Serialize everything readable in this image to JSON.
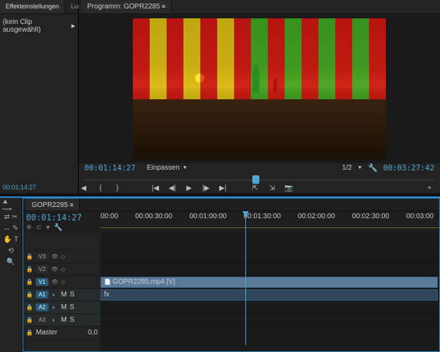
{
  "effects_panel": {
    "tab1": "Effekteinstellungen",
    "tab2": "Lume",
    "no_clip": "(kein Clip ausgewählt)",
    "timecode": "00:01:14:27"
  },
  "program": {
    "panel_label": "Programm:",
    "sequence": "GOPR2285",
    "current_tc": "00:01:14:27",
    "fit_label": "Einpassen",
    "zoom_ratio": "1/2",
    "duration_tc": "00:03:27:42"
  },
  "timeline": {
    "sequence_tab": "GOPR2285",
    "current_tc": "00:01:14:27",
    "ruler": [
      "00:00",
      "00:00:30:00",
      "00:01:00:00",
      "00:01:30:00",
      "00:02:00:00",
      "00:02:30:00",
      "00:03:00"
    ],
    "tracks": {
      "v3": "V3",
      "v2": "V2",
      "v1": "V1",
      "a1": "A1",
      "a2": "A2",
      "a3": "A3",
      "master": "Master",
      "master_val": "0,0"
    },
    "clip_video": "GOPR2285.mp4 [V]",
    "clip_audio": "fx"
  }
}
